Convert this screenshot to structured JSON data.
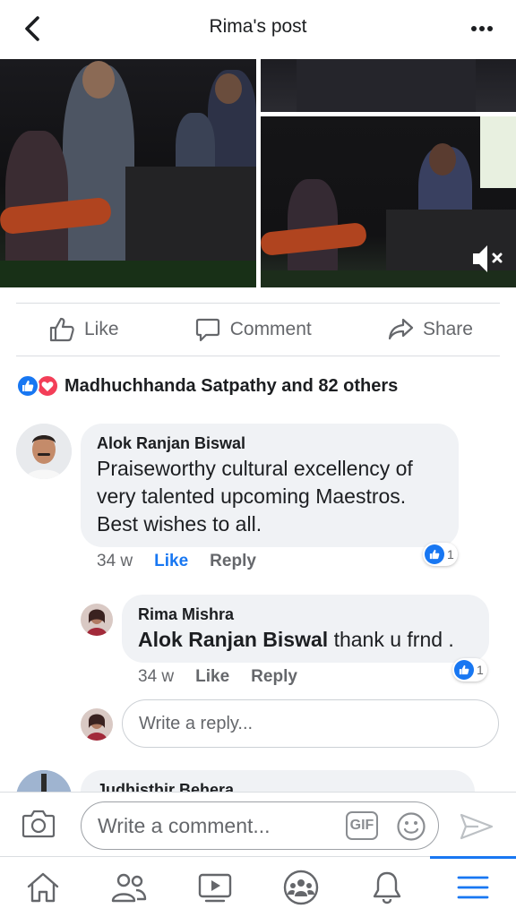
{
  "header": {
    "title": "Rima's post",
    "back_icon": "chevron-left-icon",
    "more_icon": "more-horizontal-icon"
  },
  "actions": {
    "like_label": "Like",
    "comment_label": "Comment",
    "share_label": "Share"
  },
  "reactions": {
    "summary": "Madhuchhanda Satpathy and 82 others",
    "types": [
      "like",
      "love"
    ]
  },
  "comments": [
    {
      "author": "Alok Ranjan Biswal",
      "text": "Praiseworthy cultural excellency of very talented upcoming Maestros. Best wishes to all.",
      "time": "34 w",
      "like_label": "Like",
      "reply_label": "Reply",
      "reaction_count": "1",
      "liked": true,
      "replies": [
        {
          "author": "Rima Mishra",
          "mention": "Alok Ranjan Biswal",
          "text": "thank u frnd .",
          "time": "34 w",
          "like_label": "Like",
          "reply_label": "Reply",
          "reaction_count": "1"
        }
      ],
      "reply_placeholder": "Write a reply..."
    },
    {
      "author": "Judhisthir Behera"
    }
  ],
  "composer": {
    "placeholder": "Write a comment...",
    "gif_label": "GIF"
  },
  "colors": {
    "accent": "#1877f2",
    "love": "#f33e58",
    "bubble": "#f0f2f5",
    "muted_text": "#65676b"
  },
  "nav": [
    "home-icon",
    "friends-icon",
    "watch-icon",
    "groups-icon",
    "notifications-icon",
    "menu-icon"
  ]
}
